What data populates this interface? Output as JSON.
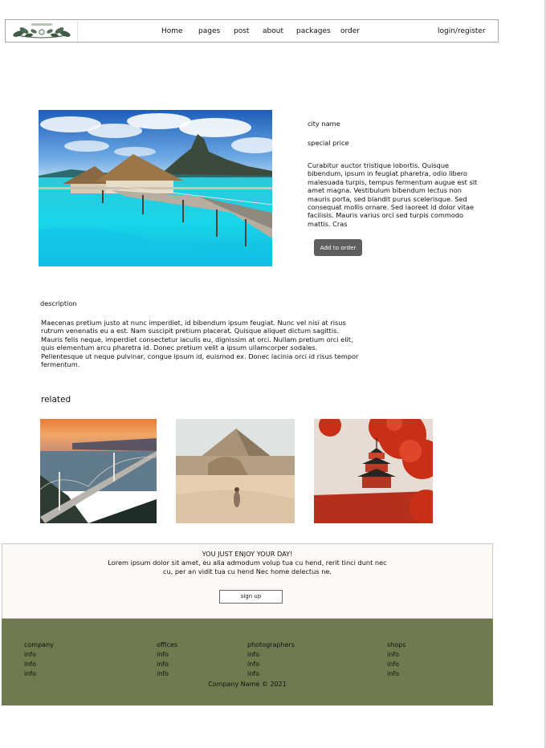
{
  "header": {
    "nav": [
      "Home",
      "pages",
      "post",
      "about",
      "packages",
      "order"
    ],
    "login": "login/register"
  },
  "product": {
    "city_name": "city name",
    "special_price": "special price",
    "summary": "Curabitur auctor tristique lobortis. Quisque bibendum, ipsum in feugiat pharetra, odio libero malesuada turpis, tempus fermentum augue est sit amet magna. Vestibulum bibendum lectus non mauris porta, sed blandit purus scelerisque. Sed consequat mollis ornare. Sed laoreet id dolor vitae facilisis. Mauris varius orci sed turpis commodo mattis. Cras",
    "add_button": "Add to order"
  },
  "description": {
    "label": "description",
    "text": "Maecenas pretium justo at nunc imperdiet, id bibendum ipsum feugiat. Nunc vel nisi at risus rutrum venenatis eu a est. Nam suscipit pretium placerat. Quisque aliquet dictum sagittis. Mauris felis neque, imperdiet consectetur iaculis eu, dignissim at orci. Nullam pretium orci elit, quis elementum arcu pharetra id. Donec pretium velit a ipsum ullamcorper sodales. Pellentesque ut neque pulvinar, congue ipsum id, euismod ex. Donec lacinia orci id risus tempor fermentum."
  },
  "related": {
    "title": "related"
  },
  "newsletter": {
    "headline": "YOU JUST ENJOY YOUR DAY!",
    "line1": "Lorem ipsum dolor sit amet, eu alia admodum volup tua cu hend, rerit tinci dunt nec",
    "line2": "cu, per an vidit tua cu hend Nec home delectus ne.",
    "button": "sign up"
  },
  "footer": {
    "columns": [
      {
        "title": "company",
        "items": [
          "info",
          "info",
          "info"
        ]
      },
      {
        "title": "offices",
        "items": [
          "info",
          "info",
          "info"
        ]
      },
      {
        "title": "photographers",
        "items": [
          "info",
          "info",
          "info"
        ]
      },
      {
        "title": "shops",
        "items": [
          "info",
          "info",
          "info"
        ]
      }
    ],
    "copyright": "Company Name © 2021"
  },
  "colors": {
    "footer_bg": "#6f7a4e",
    "button_bg": "#5e5e5e",
    "newsletter_bg": "#fdfaf6",
    "logo_green": "#3f5a44"
  }
}
